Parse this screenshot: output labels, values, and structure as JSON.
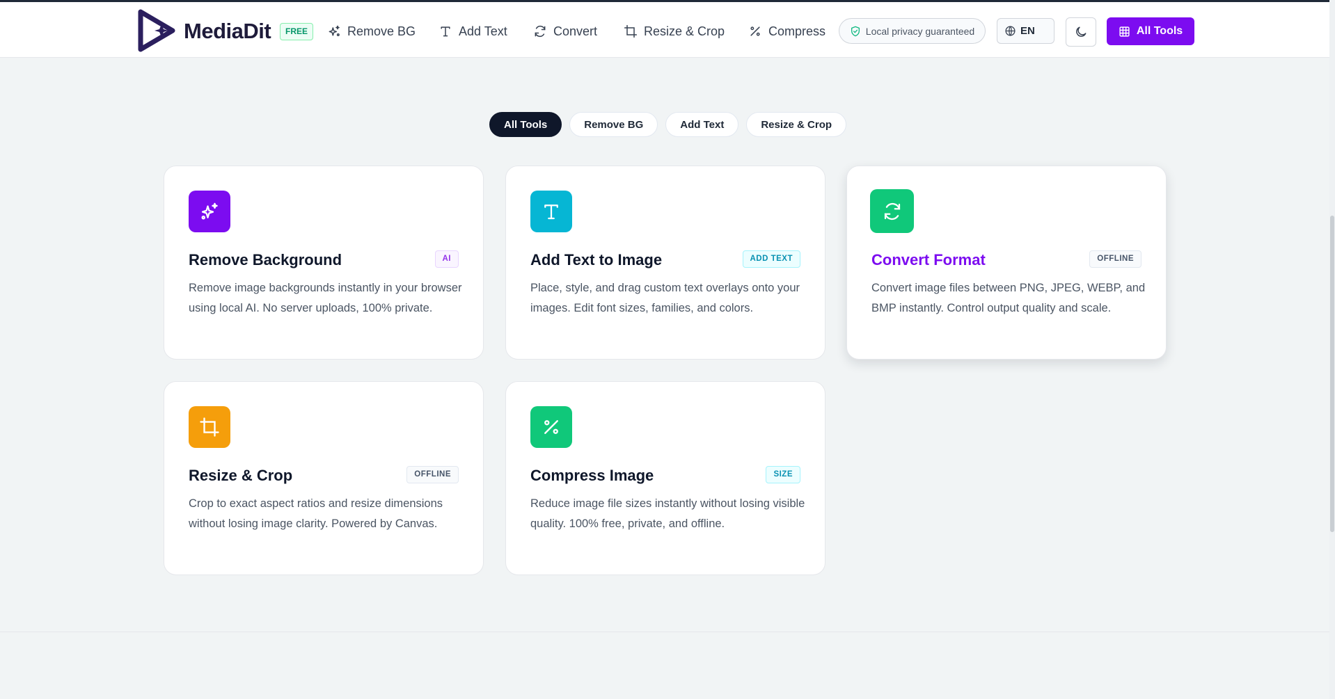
{
  "brand": {
    "name": "MediaDit",
    "badge": "FREE"
  },
  "nav": [
    {
      "label": "Remove BG",
      "icon": "sparkles-icon"
    },
    {
      "label": "Add Text",
      "icon": "text-icon"
    },
    {
      "label": "Convert",
      "icon": "refresh-icon"
    },
    {
      "label": "Resize & Crop",
      "icon": "crop-icon"
    },
    {
      "label": "Compress",
      "icon": "percent-icon"
    }
  ],
  "privacy": "Local privacy guaranteed",
  "language": "EN",
  "all_tools_button": "All Tools",
  "filters": [
    {
      "label": "All Tools",
      "active": true
    },
    {
      "label": "Remove BG",
      "active": false
    },
    {
      "label": "Add Text",
      "active": false
    },
    {
      "label": "Resize & Crop",
      "active": false
    }
  ],
  "tools": [
    {
      "title": "Remove Background",
      "badge": "AI",
      "desc": "Remove image backgrounds instantly in your browser using local AI. No server uploads, 100% private.",
      "icon": "sparkles-icon",
      "color": "#7c0cf0"
    },
    {
      "title": "Add Text to Image",
      "badge": "ADD TEXT",
      "desc": "Place, style, and drag custom text overlays onto your images. Edit font sizes, families, and colors.",
      "icon": "text-icon",
      "color": "#06b6d4"
    },
    {
      "title": "Convert Format",
      "badge": "OFFLINE",
      "desc": "Convert image files between PNG, JPEG, WEBP, and BMP instantly. Control output quality and scale.",
      "icon": "refresh-icon",
      "color": "#10c87a"
    },
    {
      "title": "Resize & Crop",
      "badge": "OFFLINE",
      "desc": "Crop to exact aspect ratios and resize dimensions without losing image clarity. Powered by Canvas.",
      "icon": "crop-icon",
      "color": "#f59e0b"
    },
    {
      "title": "Compress Image",
      "badge": "SIZE",
      "desc": "Reduce image file sizes instantly without losing visible quality. 100% free, private, and offline.",
      "icon": "percent-icon",
      "color": "#10c87a"
    }
  ],
  "colors": {
    "accent": "#7c0cf0",
    "dark": "#0f172a"
  }
}
